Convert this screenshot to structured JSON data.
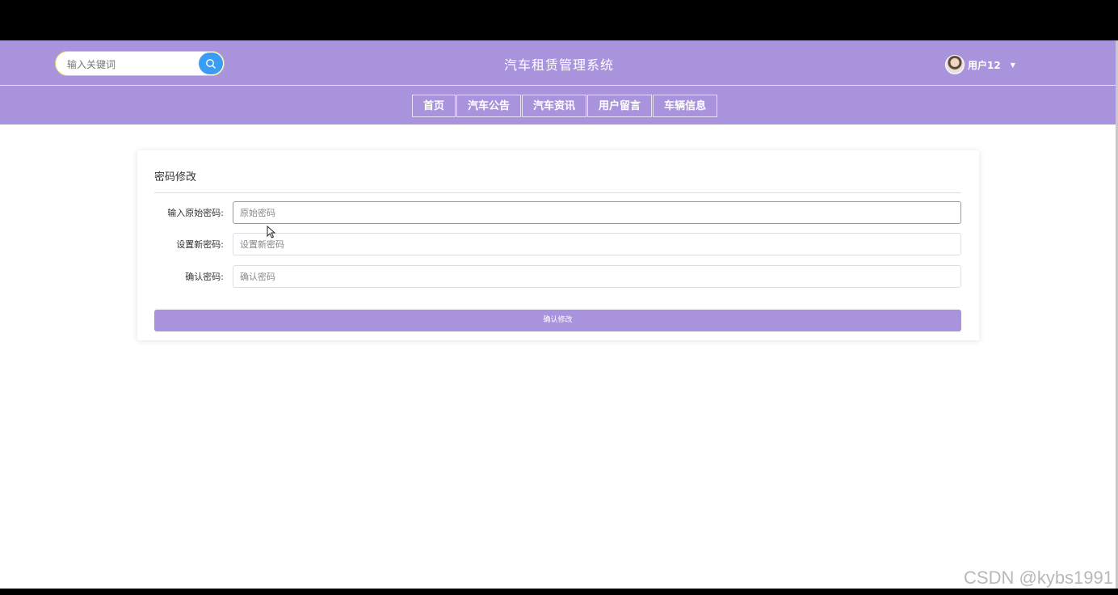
{
  "header": {
    "search_placeholder": "输入关键词",
    "title": "汽车租赁管理系统",
    "user_name": "用户12"
  },
  "nav": {
    "items": [
      "首页",
      "汽车公告",
      "汽车资讯",
      "用户留言",
      "车辆信息"
    ]
  },
  "form": {
    "title": "密码修改",
    "fields": [
      {
        "label": "输入原始密码:",
        "placeholder": "原始密码"
      },
      {
        "label": "设置新密码:",
        "placeholder": "设置新密码"
      },
      {
        "label": "确认密码:",
        "placeholder": "确认密码"
      }
    ],
    "submit_label": "确认修改"
  },
  "watermark": "CSDN @kybs1991",
  "colors": {
    "brand": "#a993dd",
    "search_button": "#3a9cf3"
  },
  "icons": {
    "search": "search-icon",
    "caret": "caret-down-icon",
    "cursor": "mouse-cursor-icon"
  }
}
